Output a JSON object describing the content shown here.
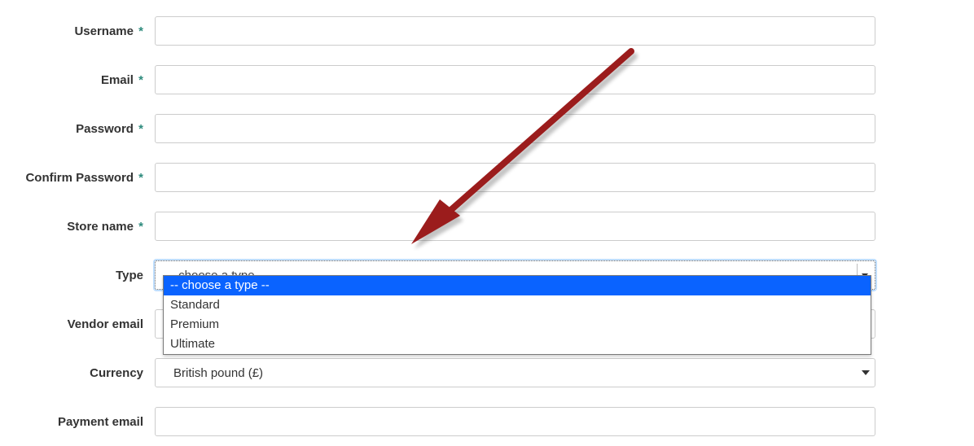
{
  "fields": {
    "username_label": "Username",
    "email_label": "Email",
    "password_label": "Password",
    "confirm_password_label": "Confirm Password",
    "store_name_label": "Store name",
    "type_label": "Type",
    "vendor_email_label": "Vendor email",
    "currency_label": "Currency",
    "payment_email_label": "Payment email",
    "required_mark": "*"
  },
  "type_select": {
    "display": "-- choose a type --",
    "options": [
      "-- choose a type --",
      "Standard",
      "Premium",
      "Ultimate"
    ],
    "selected_index": 0
  },
  "currency_select": {
    "display": "British pound (£)"
  }
}
